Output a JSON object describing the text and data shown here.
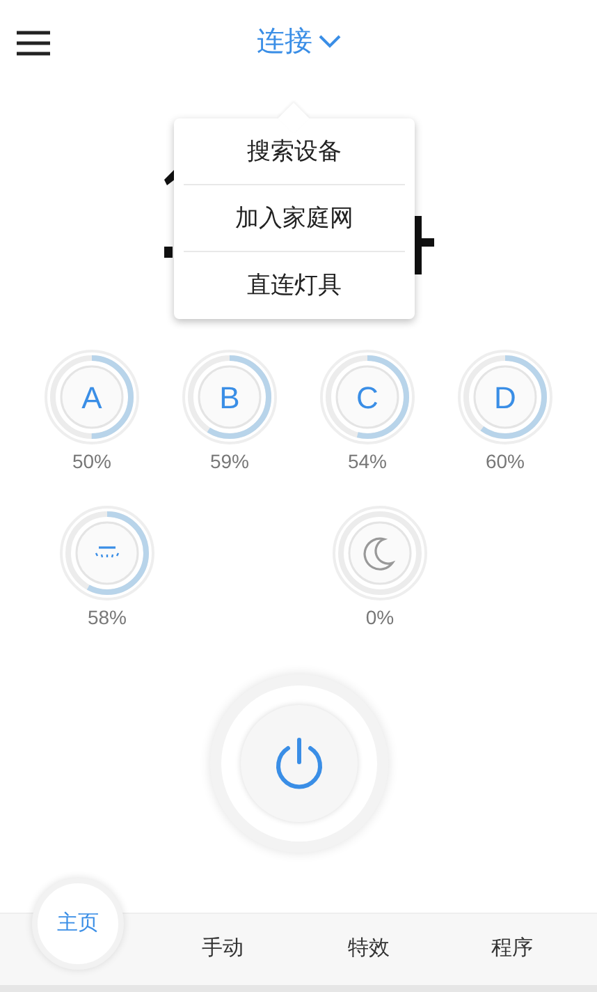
{
  "header": {
    "title": "连接"
  },
  "menu": {
    "items": [
      {
        "label": "搜索设备"
      },
      {
        "label": "加入家庭网"
      },
      {
        "label": "直连灯具"
      }
    ]
  },
  "channels": [
    {
      "kind": "letter",
      "label": "A",
      "level": 0.5,
      "reading": "50%"
    },
    {
      "kind": "letter",
      "label": "B",
      "level": 0.59,
      "reading": "59%"
    },
    {
      "kind": "letter",
      "label": "C",
      "level": 0.54,
      "reading": "54%"
    },
    {
      "kind": "letter",
      "label": "D",
      "level": 0.6,
      "reading": "60%"
    }
  ],
  "modes": [
    {
      "kind": "ceiling",
      "level": 0.58,
      "reading": "58%"
    },
    {
      "kind": "moon",
      "level": 0,
      "reading": "0%"
    }
  ],
  "tabs": [
    {
      "label": "主页",
      "selected": true
    },
    {
      "label": "手动",
      "selected": false
    },
    {
      "label": "特效",
      "selected": false
    },
    {
      "label": "程序",
      "selected": false
    }
  ]
}
